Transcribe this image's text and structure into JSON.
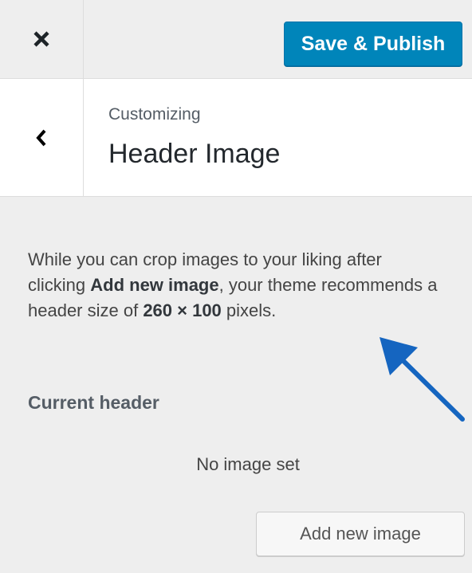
{
  "toolbar": {
    "close_icon": "close-icon",
    "save_label": "Save & Publish",
    "accent_color": "#0085ba"
  },
  "panel": {
    "back_icon": "chevron-left-icon",
    "breadcrumb": "Customizing",
    "title": "Header Image"
  },
  "description": {
    "part1": "While you can crop images to your liking after clicking ",
    "strong1": "Add new image",
    "part2": ", your theme recommends a header size of ",
    "strong2": "260 × 100",
    "part3": " pixels."
  },
  "current_header": {
    "heading": "Current header",
    "placeholder": "No image set",
    "add_button_label": "Add new image"
  },
  "annotation": {
    "arrow_icon": "annotation-arrow-icon",
    "arrow_color": "#1565c0"
  }
}
